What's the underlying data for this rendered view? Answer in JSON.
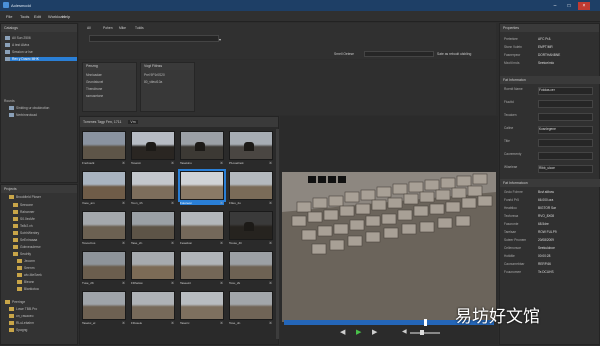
{
  "window": {
    "title": "Aolesmcdd"
  },
  "menu": [
    "File",
    "Tools",
    "Edit",
    "Workload",
    "Help"
  ],
  "left_top": {
    "header": "Catalogs",
    "items": [
      {
        "label": "All Sun 2506",
        "selected": false
      },
      {
        "label": "A test Alvira",
        "selected": false
      },
      {
        "label": "Session ur lse",
        "selected": false
      },
      {
        "label": "Rev y Dosec MHK",
        "selected": true
      }
    ],
    "group2": "Rourds",
    "group2_items": [
      "Sinkting ur obukinotion",
      "Nerbinnrotoad"
    ]
  },
  "toolbar": {
    "tabs": [
      "All",
      "Pohen",
      "Mike",
      "Tuldis"
    ],
    "search_label": "Srnell Oetese",
    "save_label": "Sate as reboolt ulsbling"
  },
  "filters": [
    {
      "header": "Penzng",
      "items": [
        "Mnnioadae",
        "Grundstuxel",
        "Thendtrone",
        "ssmusetone"
      ]
    },
    {
      "header": "Vogt Fitlnss",
      "items": [
        "Prel 9P1r0S20",
        "80_vtleut10a"
      ]
    }
  ],
  "browser": {
    "header": "Tomrnes Tagp Fen, 1711",
    "sort": "Vm",
    "clips": [
      {
        "label": "Fnoboulk",
        "sel": false,
        "sky": "#8a93a0",
        "ground": "#5e5548",
        "dark": false
      },
      {
        "label": "Toseicn",
        "sel": false,
        "sky": "#b7bcc4",
        "ground": "#2a2622",
        "dark": true
      },
      {
        "label": "Tasekinu",
        "sel": false,
        "sky": "#9ba0a6",
        "ground": "#3c3934",
        "dark": true
      },
      {
        "label": "P1oseilnok",
        "sel": false,
        "sky": "#a7adb4",
        "ground": "#4a4642",
        "dark": true
      },
      {
        "label": "Vooe_am",
        "sel": false,
        "sky": "#a9b4c0",
        "ground": "#6f5c48",
        "dark": false
      },
      {
        "label": "Toon_4h",
        "sel": false,
        "sky": "#c3c7cc",
        "ground": "#7d6e5c",
        "dark": false
      },
      {
        "label": "Fotoreon",
        "sel": true,
        "sky": "#d0d3d6",
        "ground": "#8a7a66",
        "dark": false
      },
      {
        "label": "F0eu_2u",
        "sel": false,
        "sky": "#b4b9be",
        "ground": "#7a6b58",
        "dark": false
      },
      {
        "label": "TosouCus",
        "sel": false,
        "sky": "#a4a8ac",
        "ground": "#6c6152",
        "dark": false
      },
      {
        "label": "Tase_2n",
        "sel": false,
        "sky": "#9aa0a5",
        "ground": "#5d5447",
        "dark": false
      },
      {
        "label": "Feseikon",
        "sel": false,
        "sky": "#b3b7bb",
        "ground": "#74685a",
        "dark": false
      },
      {
        "label": "Touse_4h",
        "sel": false,
        "sky": "#3a3a3a",
        "ground": "#26231f",
        "dark": true
      },
      {
        "label": "Tuse_2K",
        "sel": false,
        "sky": "#8e949a",
        "ground": "#6b5e4e",
        "dark": false
      },
      {
        "label": "FDhelsw",
        "sel": false,
        "sky": "#a6aaae",
        "ground": "#7c6b56",
        "dark": false
      },
      {
        "label": "Taseeirc",
        "sel": false,
        "sky": "#b0b4b8",
        "ground": "#746757",
        "dark": false
      },
      {
        "label": "Tosu_2k",
        "sel": false,
        "sky": "#9ca0a4",
        "ground": "#6e6253",
        "dark": false
      },
      {
        "label": "Tasekc_el",
        "sel": false,
        "sky": "#9fa4a9",
        "ground": "#6e6152",
        "dark": false
      },
      {
        "label": "FDoseiu",
        "sel": false,
        "sky": "#aeb2b6",
        "ground": "#776a5a",
        "dark": false
      },
      {
        "label": "Taseirc",
        "sel": false,
        "sky": "#b8bcc0",
        "ground": "#7e705f",
        "dark": false
      },
      {
        "label": "Tose_dn",
        "sel": false,
        "sky": "#a2a6aa",
        "ground": "#706456",
        "dark": false
      }
    ]
  },
  "left_bottom": {
    "header": "Projects",
    "root": "Brookfield Ploser",
    "items": [
      "Seecone",
      "Rahanner",
      "S0.0ecMe",
      "Te8r2.vh",
      "SotrlrWenbry",
      "SeEniraaaa",
      "Gobveoulerrw",
      "Seulrtly",
      "Jeoorm",
      "Seenm",
      "wlc.MeSeek",
      "Bleonn",
      "Blarkiotoa"
    ],
    "group2": "Peeringe",
    "group2_items": [
      "Lowe TBB.Pro",
      "on_rasaoeo",
      "RLuLebahm",
      "Spagng"
    ]
  },
  "player": {
    "timecode": "00:00:28"
  },
  "properties": {
    "header": "Properties",
    "rows": [
      {
        "k": "Preterkee",
        "v": "AFC Pr&"
      },
      {
        "k": "Stcnn Vuletn",
        "v": "EMPT/MR"
      },
      {
        "k": "Fasnerpeor",
        "v": "DORTHANBNE"
      },
      {
        "k": "Mxolt lrnds",
        "v": "Seetoe/mlo"
      }
    ],
    "section2": "Fat Informaton",
    "fields": [
      {
        "k": "Roenlt Name",
        "v": "Fotolas.cer"
      },
      {
        "k": "Fiuuttd",
        "v": ""
      },
      {
        "k": "Tecaicen",
        "v": ""
      },
      {
        "k": "Caltne",
        "v": "Kosnlegene"
      },
      {
        "k": "Titie",
        "v": ""
      },
      {
        "k": "Caorementy",
        "v": ""
      },
      {
        "k": "Wlaeleae",
        "v": "Rlbb_ulcoe"
      }
    ],
    "section3": "Fat Informatoon",
    "meta": [
      {
        "k": "Gndo Folrnre",
        "v": "Bcvl.stlbow"
      },
      {
        "k": "Fonrld Pr5",
        "v": "66.000.ora"
      },
      {
        "k": "Heabtloo",
        "v": "BIGTOR Sar"
      },
      {
        "k": "Teoforeoa",
        "v": "RVO_8X08"
      },
      {
        "k": "Fasoronte",
        "v": "68.5dre"
      },
      {
        "k": "Tarelsae",
        "v": "ROW FULP9"
      },
      {
        "k": "Suteer Pnonem",
        "v": "20/08/2009"
      },
      {
        "k": "Cellenorsoe",
        "v": "Seekuloboe"
      },
      {
        "k": "Hotldtle",
        "v": "00:00:28"
      },
      {
        "k": "Caonunrebbar",
        "v": "RERP.66"
      },
      {
        "k": "Fouunomee",
        "v": "Te.DCUHS"
      }
    ]
  },
  "watermark": "易坊好文馆"
}
